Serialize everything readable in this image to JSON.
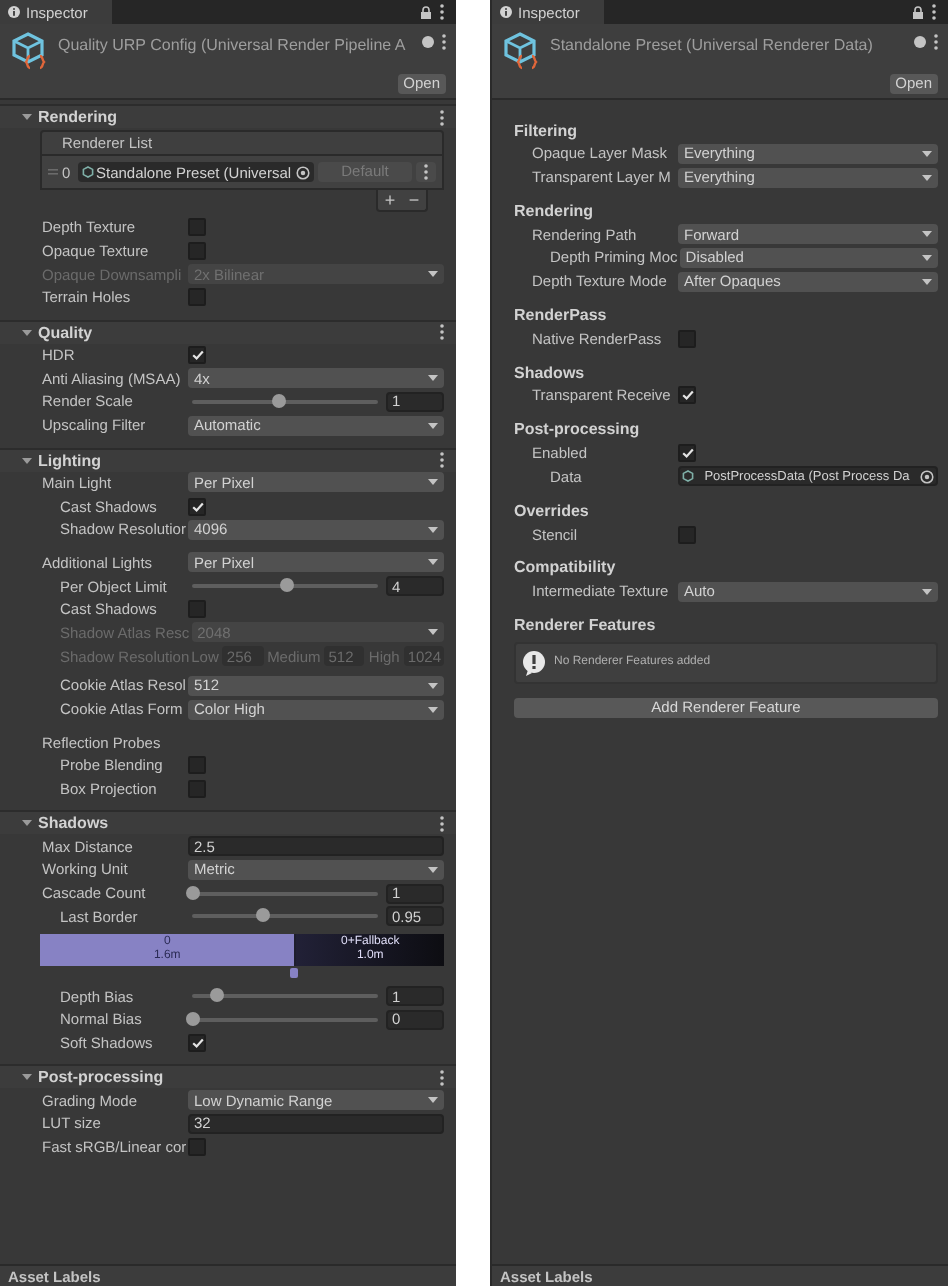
{
  "left": {
    "tab": {
      "label": "Inspector"
    },
    "title": "Quality URP Config (Universal Render Pipeline A",
    "open_button": "Open",
    "sections": [
      {
        "title": "Rendering",
        "expanded": true,
        "renderer_list": {
          "title": "Renderer List",
          "items": [
            {
              "index": "0",
              "name": "Standalone Preset (Universal",
              "button": "Default"
            }
          ],
          "add": "+",
          "remove": "−"
        },
        "groups": [
          {
            "rows": [
              {
                "kind": "checkbox",
                "label": "Depth Texture",
                "checked": false,
                "disabled": false
              },
              {
                "kind": "checkbox",
                "label": "Opaque Texture",
                "checked": false,
                "disabled": false
              },
              {
                "kind": "dropdown",
                "label": "Opaque Downsampli",
                "value": "2x Bilinear",
                "disabled": true
              },
              {
                "kind": "checkbox",
                "label": "Terrain Holes",
                "checked": false,
                "disabled": false
              }
            ]
          }
        ]
      },
      {
        "title": "Quality",
        "expanded": true,
        "groups": [
          {
            "rows": [
              {
                "kind": "checkbox",
                "label": "HDR",
                "checked": true,
                "disabled": false
              },
              {
                "kind": "dropdown",
                "label": "Anti Aliasing (MSAA)",
                "value": "4x",
                "disabled": false
              },
              {
                "kind": "slider",
                "label": "Render Scale",
                "level": 0.46,
                "value": "1",
                "disabled": false
              },
              {
                "kind": "dropdown",
                "label": "Upscaling Filter",
                "value": "Automatic",
                "disabled": false
              }
            ]
          }
        ]
      },
      {
        "title": "Lighting",
        "expanded": true,
        "groups": [
          {
            "rows": [
              {
                "kind": "dropdown",
                "label": "Main Light",
                "value": "Per Pixel",
                "disabled": false,
                "children": [
                  {
                    "kind": "checkbox",
                    "label": "Cast Shadows",
                    "checked": true,
                    "disabled": false
                  },
                  {
                    "kind": "dropdown",
                    "label": "Shadow Resolutior",
                    "value": "4096",
                    "disabled": false
                  }
                ]
              }
            ]
          },
          {
            "rows": [
              {
                "kind": "dropdown",
                "label": "Additional Lights",
                "value": "Per Pixel",
                "disabled": false,
                "children": [
                  {
                    "kind": "slider",
                    "label": "Per Object Limit",
                    "level": 0.5,
                    "value": "4",
                    "disabled": false
                  },
                  {
                    "kind": "checkbox",
                    "label": "Cast Shadows",
                    "checked": false,
                    "disabled": false
                  },
                  {
                    "kind": "dropdown",
                    "label": "Shadow Atlas Resc",
                    "value": "2048",
                    "disabled": true
                  },
                  {
                    "kind": "tiers",
                    "label": "Shadow Resolution",
                    "disabled": true,
                    "tiers": [
                      {
                        "label": "Low",
                        "value": "256"
                      },
                      {
                        "label": "Medium",
                        "value": "512"
                      },
                      {
                        "label": "High",
                        "value": "1024"
                      }
                    ]
                  },
                  {
                    "kind": "dropdown",
                    "label": "Cookie Atlas Resol",
                    "value": "512",
                    "disabled": false
                  },
                  {
                    "kind": "dropdown",
                    "label": "Cookie Atlas Form",
                    "value": "Color High",
                    "disabled": false
                  }
                ]
              }
            ]
          },
          {
            "rows": [
              {
                "kind": "label",
                "label": "Reflection Probes",
                "disabled": false,
                "children": [
                  {
                    "kind": "checkbox",
                    "label": "Probe Blending",
                    "checked": false,
                    "disabled": false
                  },
                  {
                    "kind": "checkbox",
                    "label": "Box Projection",
                    "checked": false,
                    "disabled": false
                  }
                ]
              }
            ]
          }
        ]
      },
      {
        "title": "Shadows",
        "expanded": true,
        "groups": [
          {
            "rows": [
              {
                "kind": "field",
                "label": "Max Distance",
                "value": "2.5",
                "disabled": false
              },
              {
                "kind": "dropdown",
                "label": "Working Unit",
                "value": "Metric",
                "disabled": false
              },
              {
                "kind": "slider",
                "label": "Cascade Count",
                "level": 0,
                "value": "1",
                "disabled": false,
                "children": [
                  {
                    "kind": "slider",
                    "label": "Last Border",
                    "level": 0.38,
                    "value": "0.95",
                    "disabled": false
                  },
                  {
                    "kind": "cascade",
                    "level": 0.63,
                    "segments": [
                      {
                        "label": "0",
                        "distance": "1.6m"
                      },
                      {
                        "label": "0+Fallback",
                        "distance": "1.0m"
                      }
                    ]
                  },
                  {
                    "kind": "slider",
                    "label": "Depth Bias",
                    "level": 0.13,
                    "value": "1",
                    "disabled": false
                  },
                  {
                    "kind": "slider",
                    "label": "Normal Bias",
                    "level": 0,
                    "value": "0",
                    "disabled": false
                  },
                  {
                    "kind": "checkbox",
                    "label": "Soft Shadows",
                    "checked": true,
                    "disabled": false
                  }
                ]
              }
            ]
          }
        ]
      },
      {
        "title": "Post-processing",
        "expanded": true,
        "groups": [
          {
            "rows": [
              {
                "kind": "dropdown",
                "label": "Grading Mode",
                "value": "Low Dynamic Range",
                "disabled": false
              },
              {
                "kind": "field",
                "label": "LUT size",
                "value": "32",
                "disabled": false
              },
              {
                "kind": "checkbox",
                "label": "Fast sRGB/Linear cor",
                "checked": false,
                "disabled": false
              }
            ]
          }
        ]
      }
    ],
    "footer": "Asset Labels"
  },
  "right": {
    "tab": {
      "label": "Inspector"
    },
    "title": "Standalone Preset (Universal Renderer Data)",
    "open_button": "Open",
    "groups": [
      {
        "title": "Filtering",
        "rows": [
          {
            "kind": "dropdown",
            "label": "Opaque Layer Mask",
            "value": "Everything",
            "disabled": false
          },
          {
            "kind": "dropdown",
            "label": "Transparent Layer M",
            "value": "Everything",
            "disabled": false
          }
        ]
      },
      {
        "title": "Rendering",
        "rows": [
          {
            "kind": "dropdown",
            "label": "Rendering Path",
            "value": "Forward",
            "disabled": false,
            "children": [
              {
                "kind": "dropdown",
                "label": "Depth Priming Moc",
                "value": "Disabled",
                "disabled": false
              }
            ]
          },
          {
            "kind": "dropdown",
            "label": "Depth Texture Mode",
            "value": "After Opaques",
            "disabled": false
          }
        ]
      },
      {
        "title": "RenderPass",
        "rows": [
          {
            "kind": "checkbox",
            "label": "Native RenderPass",
            "checked": false,
            "disabled": false
          }
        ]
      },
      {
        "title": "Shadows",
        "rows": [
          {
            "kind": "checkbox",
            "label": "Transparent Receive",
            "checked": true,
            "disabled": false
          }
        ]
      },
      {
        "title": "Post-processing",
        "rows": [
          {
            "kind": "checkbox",
            "label": "Enabled",
            "checked": true,
            "disabled": false,
            "children": [
              {
                "kind": "object",
                "label": "Data",
                "value": "PostProcessData (Post Process Da",
                "disabled": false
              }
            ]
          }
        ]
      },
      {
        "title": "Overrides",
        "rows": [
          {
            "kind": "checkbox",
            "label": "Stencil",
            "checked": false,
            "disabled": false
          }
        ]
      },
      {
        "title": "Compatibility",
        "rows": [
          {
            "kind": "dropdown",
            "label": "Intermediate Texture",
            "value": "Auto",
            "disabled": false
          }
        ]
      }
    ],
    "renderer_features": {
      "title": "Renderer Features",
      "message": "No Renderer Features added",
      "button": "Add Renderer Feature"
    },
    "footer": "Asset Labels"
  }
}
